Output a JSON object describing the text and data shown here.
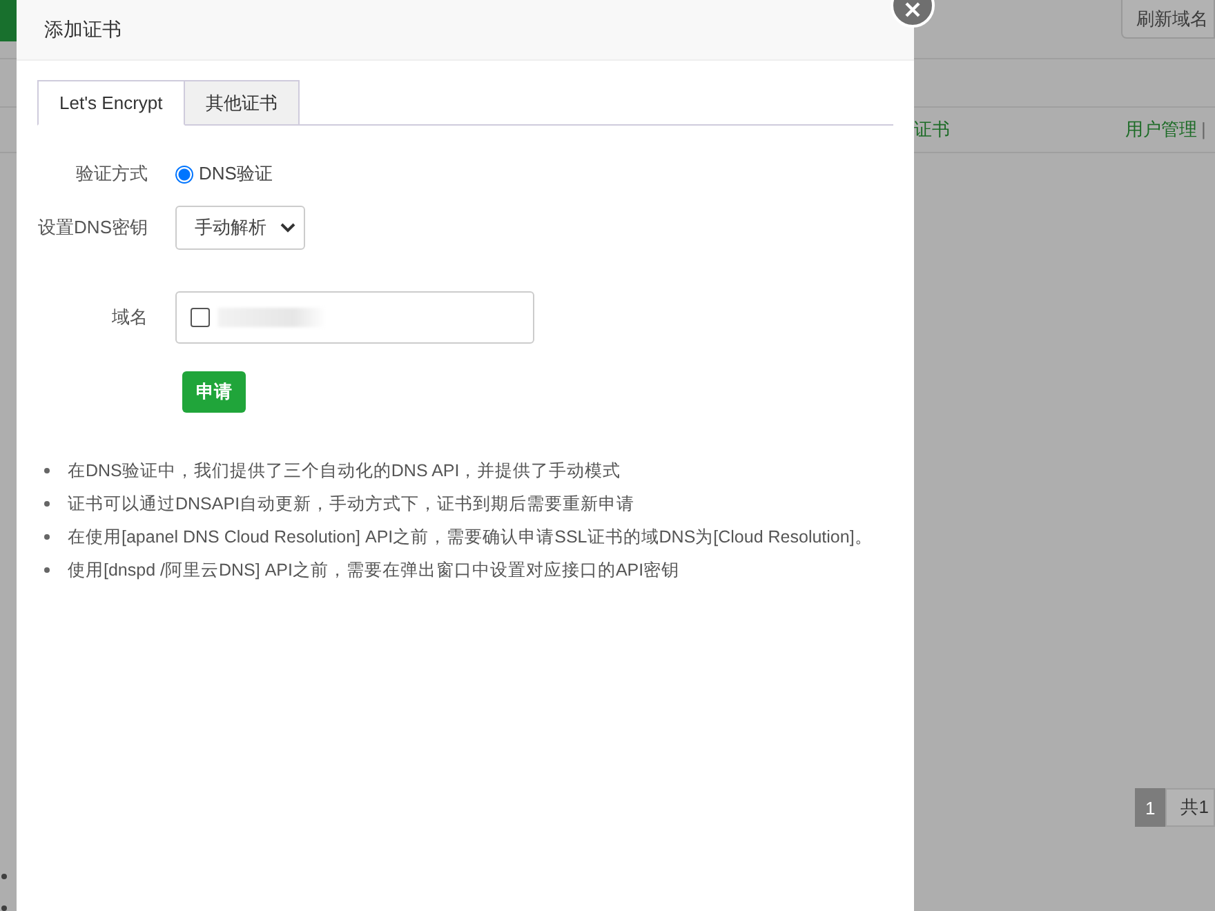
{
  "background_page": {
    "refresh_button": "刷新域名",
    "row": {
      "cert_link": "证书",
      "user_link": "用户管理",
      "separator": "|"
    },
    "pagination": {
      "pages": [
        {
          "label": "1",
          "selected": true
        }
      ],
      "total": "共1"
    }
  },
  "dialog": {
    "title": "添加证书",
    "tabs": [
      {
        "label": "Let's Encrypt",
        "selected": true
      },
      {
        "label": "其他证书",
        "selected": false
      }
    ],
    "form": {
      "verify_label": "验证方式",
      "verify_options": [
        {
          "label": "DNS验证",
          "selected": true
        }
      ],
      "dns_key_label": "设置DNS密钥",
      "dns_key_value": "手动解析",
      "domain_label": "域名",
      "domains": [
        {
          "checked": false
        }
      ],
      "submit": "申请"
    },
    "notes": [
      "在DNS验证中，我们提供了三个自动化的DNS API，并提供了手动模式",
      "证书可以通过DNSAPI自动更新，手动方式下，证书到期后需要重新申请",
      "在使用[apanel DNS Cloud Resolution] API之前，需要确认申请SSL证书的域DNS为[Cloud Resolution]。",
      "使用[dnspd /阿里云DNS] API之前，需要在弹出窗口中设置对应接口的API密钥"
    ]
  }
}
